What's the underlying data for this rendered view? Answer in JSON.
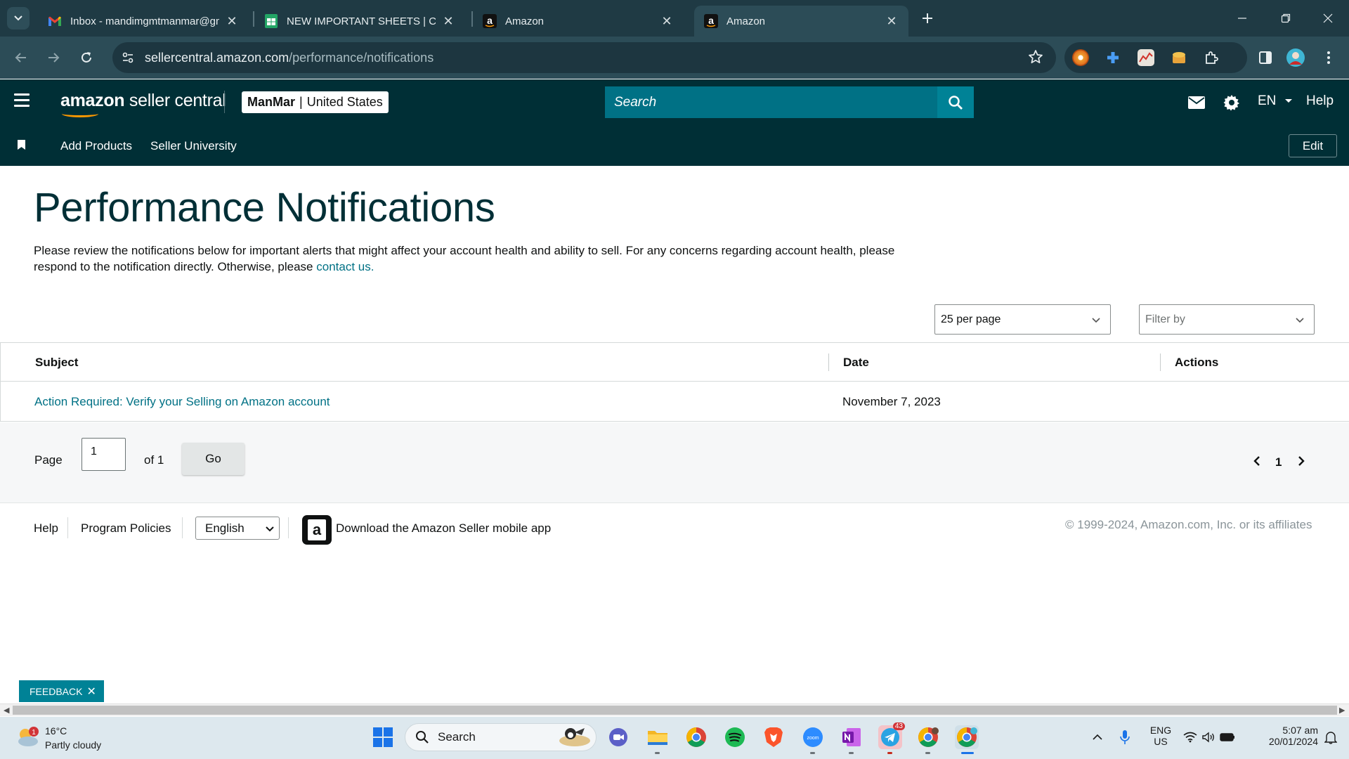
{
  "browser": {
    "tabs": [
      {
        "title": "Inbox - mandimgmtmanmar@gmail.com",
        "icon": "gmail-icon"
      },
      {
        "title": "NEW IMPORTANT SHEETS | Cyril - Google Sheets",
        "icon": "sheets-icon"
      },
      {
        "title": "Amazon",
        "icon": "amazon-icon"
      },
      {
        "title": "Amazon",
        "icon": "amazon-icon",
        "active": true
      }
    ],
    "url_domain": "sellercentral.amazon.com",
    "url_path": "/performance/notifications"
  },
  "header": {
    "logo_bold": "amazon",
    "logo_rest": " seller central",
    "store_name": "ManMar",
    "store_sep": "|",
    "store_region": "United States",
    "search_placeholder": "Search",
    "language": "EN",
    "help": "Help"
  },
  "subnav": {
    "links": [
      "Add Products",
      "Seller University"
    ],
    "edit": "Edit"
  },
  "main": {
    "title": "Performance Notifications",
    "intro_text": "Please review the notifications below for important alerts that might affect your account health and ability to sell. For any concerns regarding account health, please respond to the notification directly. Otherwise, please ",
    "intro_link": "contact us.",
    "per_page": "25 per page",
    "filter_placeholder": "Filter by",
    "table": {
      "headers": [
        "Subject",
        "Date",
        "Actions"
      ],
      "rows": [
        {
          "subject": "Action Required: Verify your Selling on Amazon account",
          "date": "November 7, 2023",
          "actions": ""
        }
      ]
    },
    "pager": {
      "page_label": "Page",
      "page_value": "1",
      "of_label": "of 1",
      "go": "Go",
      "current": "1"
    }
  },
  "footer": {
    "help": "Help",
    "program_policies": "Program Policies",
    "language": "English",
    "app_text": "Download the Amazon Seller mobile app",
    "copyright": "© 1999-2024, Amazon.com, Inc. or its affiliates"
  },
  "feedback": {
    "label": "FEEDBACK",
    "close": "✕"
  },
  "taskbar": {
    "weather_temp": "16°C",
    "weather_desc": "Partly cloudy",
    "weather_badge": "1",
    "search": "Search",
    "telegram_badge": "43",
    "lang_top": "ENG",
    "lang_bottom": "US",
    "time": "5:07 am",
    "date": "20/01/2024"
  },
  "colors": {
    "header_bg": "#002f36",
    "search_field": "#007185",
    "search_button": "#008296",
    "link": "#007185",
    "title": "#002f36",
    "browser_tabbar": "#1f3a44",
    "browser_toolbar": "#2c4c57",
    "taskbar": "#dde8ee"
  }
}
